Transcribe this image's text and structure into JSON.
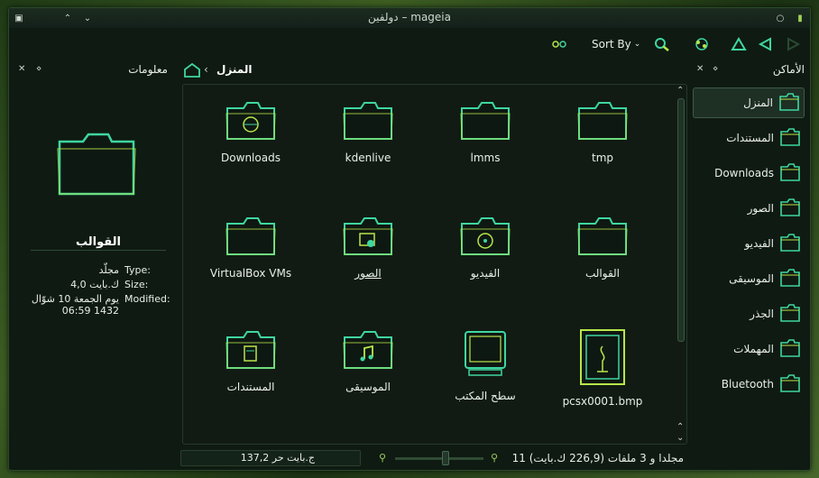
{
  "window": {
    "title": "دولفين – mageia",
    "colors": {
      "accent": "#3fd6a0",
      "glow": "#b7e64a",
      "background": "#0f1a12"
    }
  },
  "toolbar": {
    "sort_label": "Sort By"
  },
  "info_panel": {
    "header": "معلومات",
    "name": "القوالب",
    "rows": [
      {
        "key": "Type:",
        "value": "مجلّد"
      },
      {
        "key": "Size:",
        "value": "4,0 ك.بايت"
      },
      {
        "key": "Modified:",
        "value": "يوم الجمعة 10 شوّال 1432 06:59"
      }
    ]
  },
  "breadcrumb": {
    "location": "المنزل"
  },
  "items": [
    {
      "label": "Downloads",
      "icon": "folder-downloads-icon"
    },
    {
      "label": "kdenlive",
      "icon": "folder-icon"
    },
    {
      "label": "lmms",
      "icon": "folder-icon"
    },
    {
      "label": "tmp",
      "icon": "folder-icon"
    },
    {
      "label": "VirtualBox VMs",
      "icon": "folder-icon"
    },
    {
      "label": "الصور",
      "icon": "folder-pictures-icon"
    },
    {
      "label": "الفيديو",
      "icon": "folder-video-icon"
    },
    {
      "label": "القوالب",
      "icon": "folder-icon"
    },
    {
      "label": "المستندات",
      "icon": "folder-documents-icon"
    },
    {
      "label": "الموسيقى",
      "icon": "folder-music-icon"
    },
    {
      "label": "سطح المكتب",
      "icon": "desktop-icon"
    },
    {
      "label": "pcsx0001.bmp",
      "icon": "image-file-icon"
    }
  ],
  "status": {
    "free_space": "137,2 ج.بايت حر",
    "summary": "11 مجلدا و 3 ملفات (226,9 ك.بايت)"
  },
  "places": {
    "header": "الأماكن",
    "items": [
      {
        "label": "المنزل",
        "icon": "home-icon"
      },
      {
        "label": "المستندات",
        "icon": "documents-folder-icon"
      },
      {
        "label": "Downloads",
        "icon": "downloads-folder-icon"
      },
      {
        "label": "الصور",
        "icon": "pictures-folder-icon"
      },
      {
        "label": "الفيديو",
        "icon": "video-folder-icon"
      },
      {
        "label": "الموسيقى",
        "icon": "music-folder-icon"
      },
      {
        "label": "الجذر",
        "icon": "root-icon"
      },
      {
        "label": "المهملات",
        "icon": "trash-icon"
      },
      {
        "label": "Bluetooth",
        "icon": "bluetooth-icon"
      }
    ]
  }
}
